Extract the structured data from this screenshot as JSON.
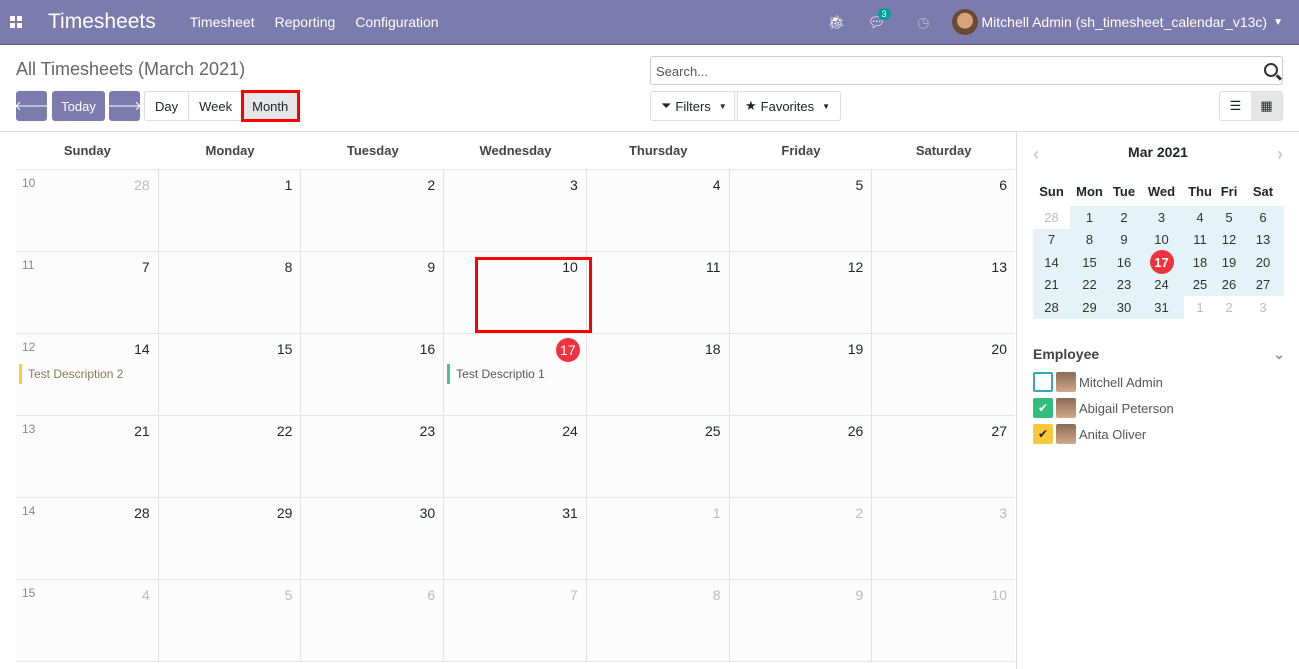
{
  "nav": {
    "app_title": "Timesheets",
    "menus": [
      "Timesheet",
      "Reporting",
      "Configuration"
    ],
    "messages_count": "3",
    "user": "Mitchell Admin (sh_timesheet_calendar_v13c)"
  },
  "page": {
    "title": "All Timesheets (March 2021)",
    "today": "Today",
    "views": [
      "Day",
      "Week",
      "Month"
    ],
    "active_view": "Month",
    "search_placeholder": "Search...",
    "filters": "Filters",
    "favorites": "Favorites"
  },
  "calendar": {
    "weekdays": [
      "Sunday",
      "Monday",
      "Tuesday",
      "Wednesday",
      "Thursday",
      "Friday",
      "Saturday"
    ],
    "weeks": [
      {
        "num": "10",
        "days": [
          [
            "28",
            1
          ],
          [
            "1",
            0
          ],
          [
            "2",
            0
          ],
          [
            "3",
            0
          ],
          [
            "4",
            0
          ],
          [
            "5",
            0
          ],
          [
            "6",
            0
          ]
        ]
      },
      {
        "num": "11",
        "days": [
          [
            "7",
            0
          ],
          [
            "8",
            0
          ],
          [
            "9",
            0
          ],
          [
            "10",
            0
          ],
          [
            "11",
            0
          ],
          [
            "12",
            0
          ],
          [
            "13",
            0
          ]
        ]
      },
      {
        "num": "12",
        "days": [
          [
            "14",
            0
          ],
          [
            "15",
            0
          ],
          [
            "16",
            0
          ],
          [
            "17",
            0
          ],
          [
            "18",
            0
          ],
          [
            "19",
            0
          ],
          [
            "20",
            0
          ]
        ]
      },
      {
        "num": "13",
        "days": [
          [
            "21",
            0
          ],
          [
            "22",
            0
          ],
          [
            "23",
            0
          ],
          [
            "24",
            0
          ],
          [
            "25",
            0
          ],
          [
            "26",
            0
          ],
          [
            "27",
            0
          ]
        ]
      },
      {
        "num": "14",
        "days": [
          [
            "28",
            0
          ],
          [
            "29",
            0
          ],
          [
            "30",
            0
          ],
          [
            "31",
            0
          ],
          [
            "1",
            1
          ],
          [
            "2",
            1
          ],
          [
            "3",
            1
          ]
        ]
      },
      {
        "num": "15",
        "days": [
          [
            "4",
            1
          ],
          [
            "5",
            1
          ],
          [
            "6",
            1
          ],
          [
            "7",
            1
          ],
          [
            "8",
            1
          ],
          [
            "9",
            1
          ],
          [
            "10",
            1
          ]
        ]
      }
    ],
    "today": "17",
    "events": [
      {
        "week": 2,
        "day": 0,
        "title": "Test Description 2",
        "color": "#f7cd3e",
        "text_color": "#8a7a50"
      },
      {
        "week": 2,
        "day": 3,
        "title": "Test Descriptio 1",
        "color": "#4cc18c",
        "text_color": "#555"
      }
    ]
  },
  "mini": {
    "title": "Mar 2021",
    "weekdays": [
      "Sun",
      "Mon",
      "Tue",
      "Wed",
      "Thu",
      "Fri",
      "Sat"
    ],
    "days": [
      [
        "28",
        1
      ],
      [
        "1",
        0
      ],
      [
        "2",
        0
      ],
      [
        "3",
        0
      ],
      [
        "4",
        0
      ],
      [
        "5",
        0
      ],
      [
        "6",
        0
      ],
      [
        "7",
        0
      ],
      [
        "8",
        0
      ],
      [
        "9",
        0
      ],
      [
        "10",
        0
      ],
      [
        "11",
        0
      ],
      [
        "12",
        0
      ],
      [
        "13",
        0
      ],
      [
        "14",
        0
      ],
      [
        "15",
        0
      ],
      [
        "16",
        0
      ],
      [
        "17",
        0
      ],
      [
        "18",
        0
      ],
      [
        "19",
        0
      ],
      [
        "20",
        0
      ],
      [
        "21",
        0
      ],
      [
        "22",
        0
      ],
      [
        "23",
        0
      ],
      [
        "24",
        0
      ],
      [
        "25",
        0
      ],
      [
        "26",
        0
      ],
      [
        "27",
        0
      ],
      [
        "28",
        0
      ],
      [
        "29",
        0
      ],
      [
        "30",
        0
      ],
      [
        "31",
        0
      ],
      [
        "1",
        1
      ],
      [
        "2",
        1
      ],
      [
        "3",
        1
      ]
    ]
  },
  "filter": {
    "title": "Employee",
    "employees": [
      {
        "name": "Mitchell Admin",
        "checked": false,
        "color": "#30a8bf"
      },
      {
        "name": "Abigail Peterson",
        "checked": true,
        "color": "#2fbf7b"
      },
      {
        "name": "Anita Oliver",
        "checked": true,
        "color": "#f8c73a"
      }
    ]
  }
}
